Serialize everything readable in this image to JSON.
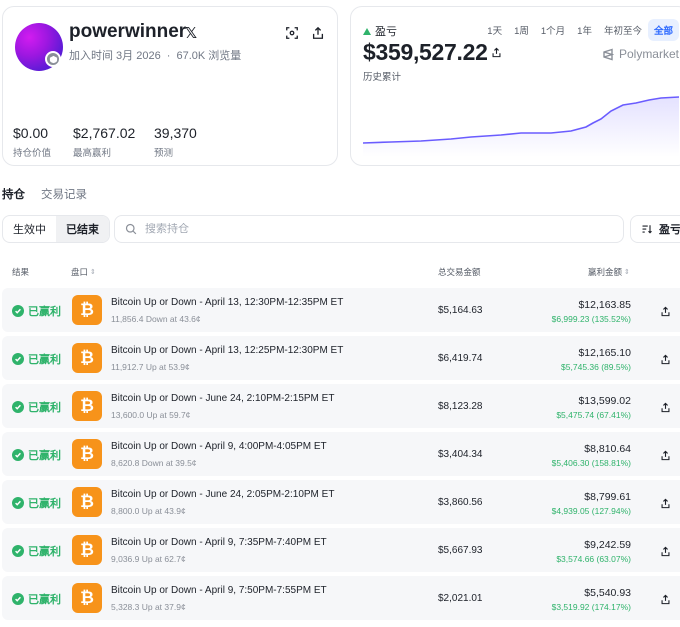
{
  "profile": {
    "username": "powerwinner",
    "x_label": "𝕏",
    "joined": "加入时间 3月 2026",
    "dot": "·",
    "views": "67.0K 浏览量",
    "stats": [
      {
        "value": "$0.00",
        "label": "持仓价值"
      },
      {
        "value": "$2,767.02",
        "label": "最高赢利"
      },
      {
        "value": "39,370",
        "label": "预测"
      }
    ]
  },
  "pnl": {
    "label": "盈亏",
    "value": "$359,527.22",
    "sublabel": "历史累计",
    "brand": "Polymarket",
    "ranges": [
      "1天",
      "1周",
      "1个月",
      "1年",
      "年初至今",
      "全部"
    ],
    "active_range": "全部",
    "accent_color": "#6a5cff"
  },
  "tabs": [
    "持仓",
    "交易记录"
  ],
  "filter": {
    "segments": [
      "生效中",
      "已结束"
    ],
    "active_segment": "已结束",
    "search_placeholder": "搜索持仓",
    "sort_label": "盈亏"
  },
  "table": {
    "headers": {
      "result": "结果",
      "market": "盘口",
      "total": "总交易金额",
      "win": "赢利金额"
    },
    "rows": [
      {
        "result": "已赢利",
        "title": "Bitcoin Up or Down - April 13, 12:30PM-12:35PM ET",
        "sub": "11,856.4 Down at 43.6¢",
        "total": "$5,164.63",
        "win": "$12,163.85",
        "win_sub": "$6,999.23 (135.52%)"
      },
      {
        "result": "已赢利",
        "title": "Bitcoin Up or Down - April 13, 12:25PM-12:30PM ET",
        "sub": "11,912.7 Up at 53.9¢",
        "total": "$6,419.74",
        "win": "$12,165.10",
        "win_sub": "$5,745.36 (89.5%)"
      },
      {
        "result": "已赢利",
        "title": "Bitcoin Up or Down - June 24, 2:10PM-2:15PM ET",
        "sub": "13,600.0 Up at 59.7¢",
        "total": "$8,123.28",
        "win": "$13,599.02",
        "win_sub": "$5,475.74 (67.41%)"
      },
      {
        "result": "已赢利",
        "title": "Bitcoin Up or Down - April 9, 4:00PM-4:05PM ET",
        "sub": "8,620.8 Down at 39.5¢",
        "total": "$3,404.34",
        "win": "$8,810.64",
        "win_sub": "$5,406.30 (158.81%)"
      },
      {
        "result": "已赢利",
        "title": "Bitcoin Up or Down - June 24, 2:05PM-2:10PM ET",
        "sub": "8,800.0 Up at 43.9¢",
        "total": "$3,860.56",
        "win": "$8,799.61",
        "win_sub": "$4,939.05 (127.94%)"
      },
      {
        "result": "已赢利",
        "title": "Bitcoin Up or Down - April 9, 7:35PM-7:40PM ET",
        "sub": "9,036.9 Up at 62.7¢",
        "total": "$5,667.93",
        "win": "$9,242.59",
        "win_sub": "$3,574.66 (63.07%)"
      },
      {
        "result": "已赢利",
        "title": "Bitcoin Up or Down - April 9, 7:50PM-7:55PM ET",
        "sub": "5,328.3 Up at 37.9¢",
        "total": "$2,021.01",
        "win": "$5,540.93",
        "win_sub": "$3,519.92 (174.17%)"
      }
    ]
  }
}
